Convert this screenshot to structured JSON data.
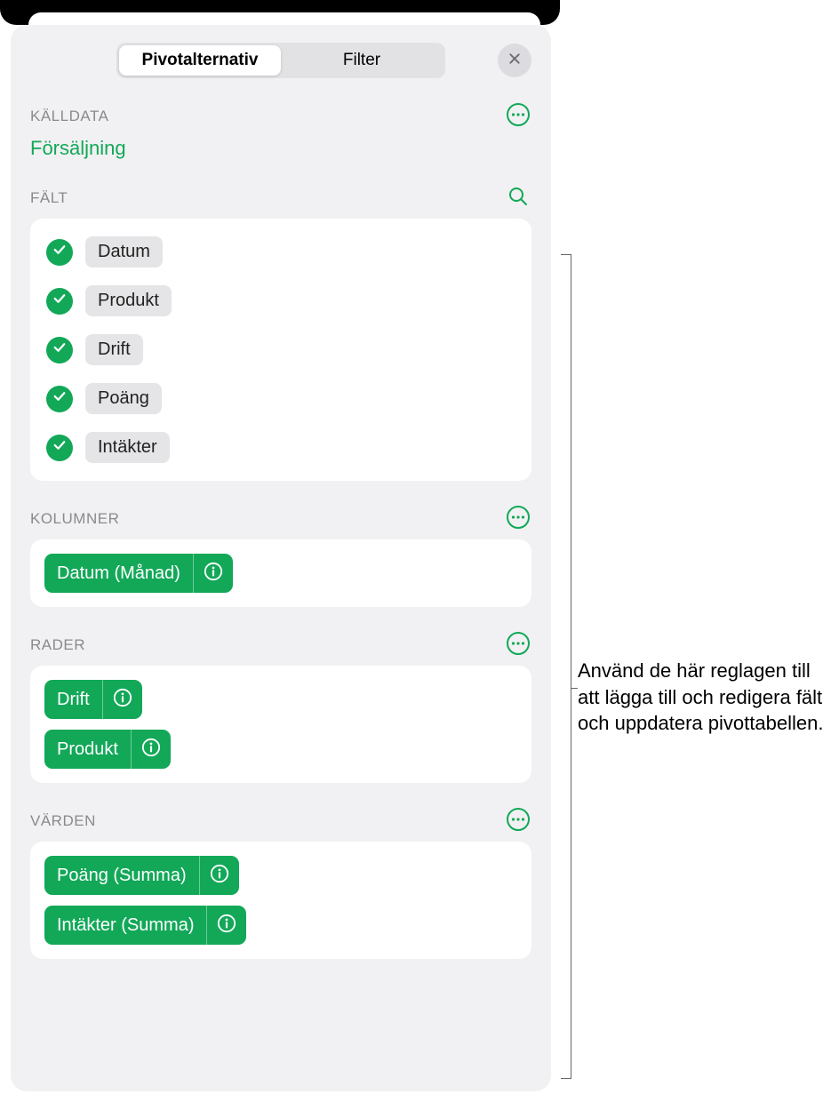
{
  "tabs": {
    "pivot": "Pivotalternativ",
    "filter": "Filter"
  },
  "sections": {
    "source_label": "KÄLLDATA",
    "source_name": "Försäljning",
    "fields_label": "FÄLT",
    "columns_label": "KOLUMNER",
    "rows_label": "RADER",
    "values_label": "VÄRDEN"
  },
  "fields": [
    {
      "label": "Datum"
    },
    {
      "label": "Produkt"
    },
    {
      "label": "Drift"
    },
    {
      "label": "Poäng"
    },
    {
      "label": "Intäkter"
    }
  ],
  "columns": [
    {
      "label": "Datum (Månad)"
    }
  ],
  "rows": [
    {
      "label": "Drift"
    },
    {
      "label": "Produkt"
    }
  ],
  "values": [
    {
      "label": "Poäng (Summa)"
    },
    {
      "label": "Intäkter (Summa)"
    }
  ],
  "callout": "Använd de här reglagen till att lägga till och redigera fält och uppdatera pivottabellen."
}
